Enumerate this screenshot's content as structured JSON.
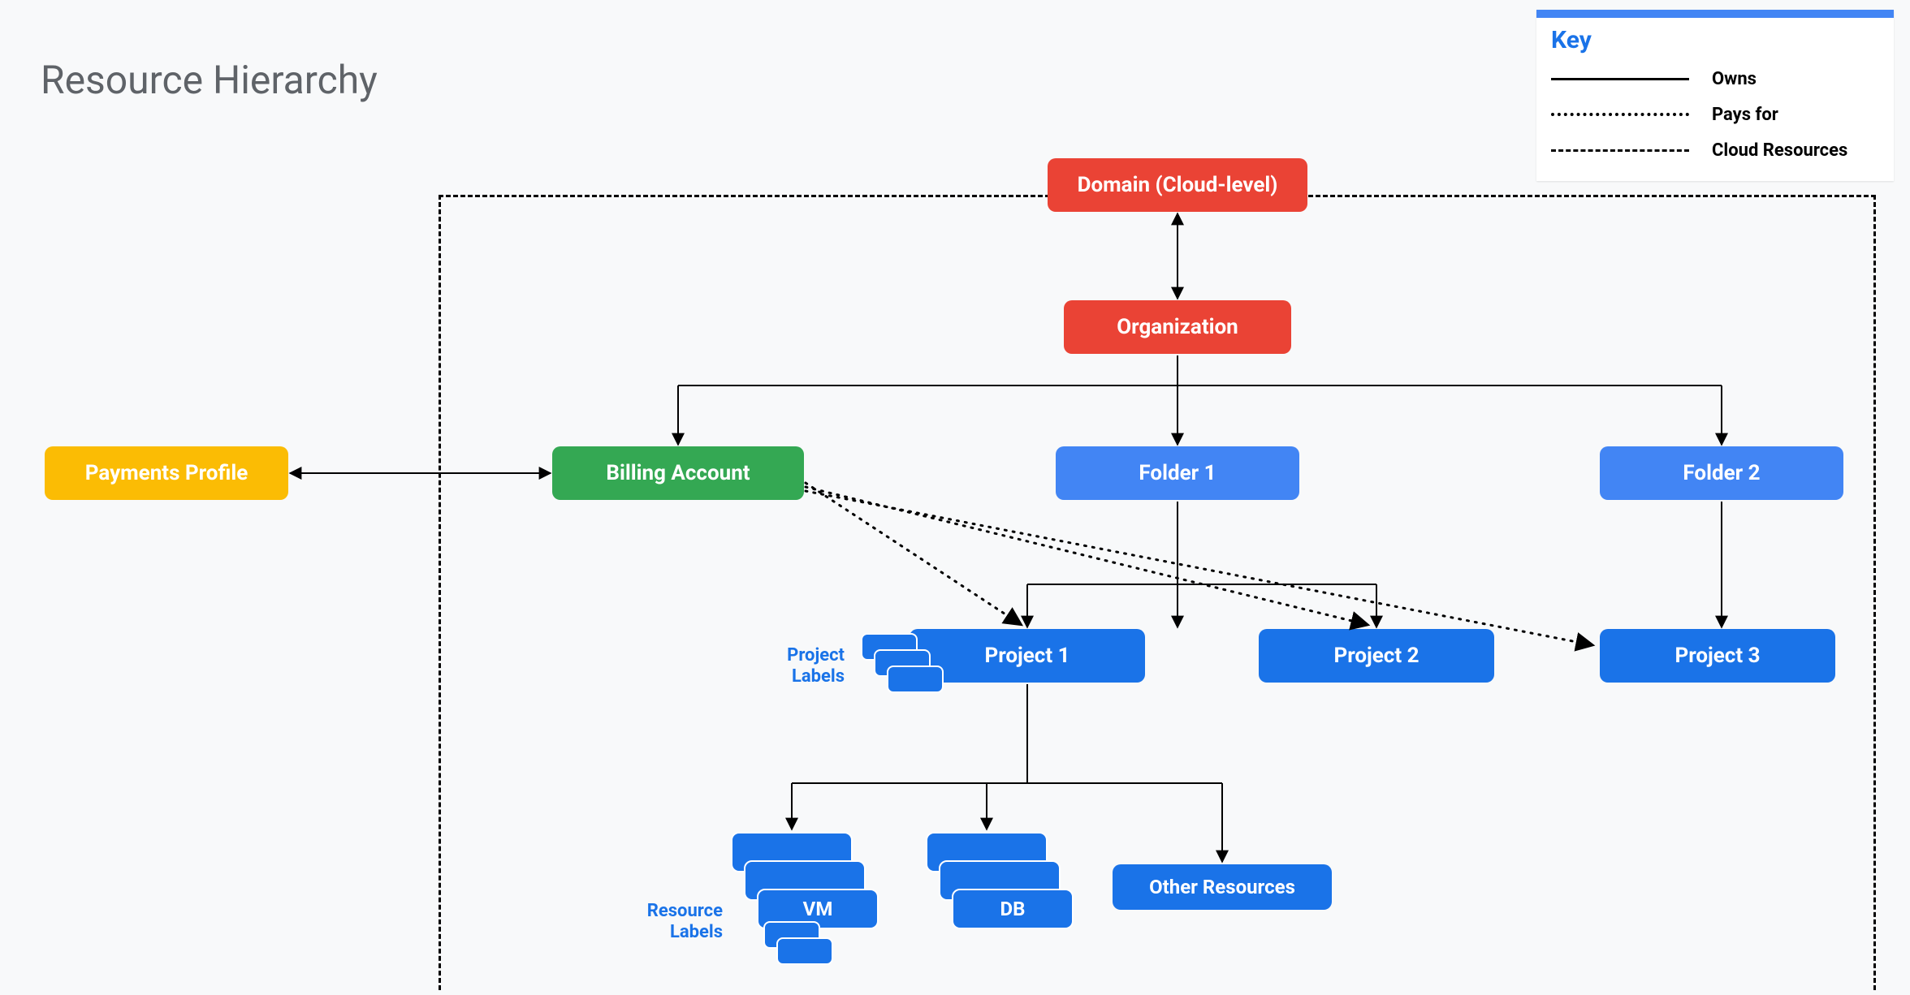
{
  "title": "Resource Hierarchy",
  "legend": {
    "heading": "Key",
    "items": [
      {
        "style": "solid",
        "label": "Owns"
      },
      {
        "style": "dotted",
        "label": "Pays for"
      },
      {
        "style": "dashed",
        "label": "Cloud Resources"
      }
    ]
  },
  "nodes": {
    "domain": "Domain (Cloud-level)",
    "organization": "Organization",
    "payments": "Payments Profile",
    "billing": "Billing Account",
    "folder1": "Folder 1",
    "folder2": "Folder 2",
    "project1": "Project 1",
    "project2": "Project 2",
    "project3": "Project 3",
    "other": "Other Resources",
    "vm": "VM",
    "db": "DB"
  },
  "labels": {
    "projectLabels": "Project\nLabels",
    "resourceLabels": "Resource\nLabels"
  }
}
